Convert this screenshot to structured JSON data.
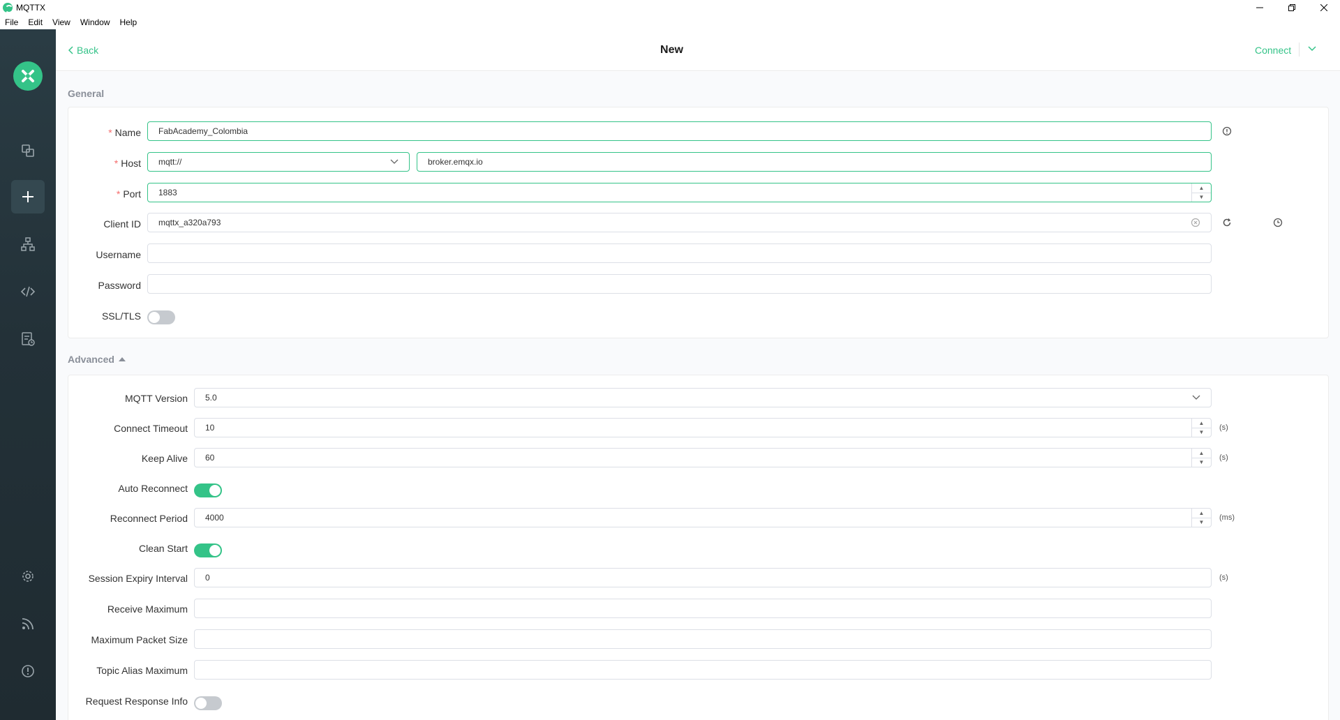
{
  "window": {
    "title": "MQTTX"
  },
  "menu": [
    "File",
    "Edit",
    "View",
    "Window",
    "Help"
  ],
  "header": {
    "back_label": "Back",
    "title": "New",
    "connect_label": "Connect"
  },
  "general": {
    "section_title": "General",
    "name": {
      "label": "Name",
      "value": "FabAcademy_Colombia"
    },
    "host": {
      "label": "Host",
      "protocol": "mqtt://",
      "value": "broker.emqx.io"
    },
    "port": {
      "label": "Port",
      "value": "1883"
    },
    "client_id": {
      "label": "Client ID",
      "value": "mqttx_a320a793"
    },
    "username": {
      "label": "Username",
      "value": ""
    },
    "password": {
      "label": "Password",
      "value": ""
    },
    "ssl": {
      "label": "SSL/TLS",
      "enabled": false
    }
  },
  "advanced": {
    "section_title": "Advanced",
    "mqtt_version": {
      "label": "MQTT Version",
      "value": "5.0"
    },
    "connect_timeout": {
      "label": "Connect Timeout",
      "value": "10",
      "unit": "(s)"
    },
    "keep_alive": {
      "label": "Keep Alive",
      "value": "60",
      "unit": "(s)"
    },
    "auto_reconnect": {
      "label": "Auto Reconnect",
      "enabled": true
    },
    "reconnect_period": {
      "label": "Reconnect Period",
      "value": "4000",
      "unit": "(ms)"
    },
    "clean_start": {
      "label": "Clean Start",
      "enabled": true
    },
    "session_expiry": {
      "label": "Session Expiry Interval",
      "value": "0",
      "unit": "(s)"
    },
    "receive_maximum": {
      "label": "Receive Maximum",
      "value": ""
    },
    "max_packet_size": {
      "label": "Maximum Packet Size",
      "value": ""
    },
    "topic_alias_max": {
      "label": "Topic Alias Maximum",
      "value": ""
    },
    "request_response_info": {
      "label": "Request Response Info",
      "enabled": false
    }
  },
  "colors": {
    "accent": "#34c388",
    "sidebar": "#233138",
    "required": "#f56c6c"
  },
  "icons": {
    "sidebar": [
      "connections-icon",
      "new-connection-icon",
      "topology-icon",
      "script-icon",
      "log-icon",
      "settings-icon",
      "feed-icon",
      "about-icon"
    ]
  }
}
